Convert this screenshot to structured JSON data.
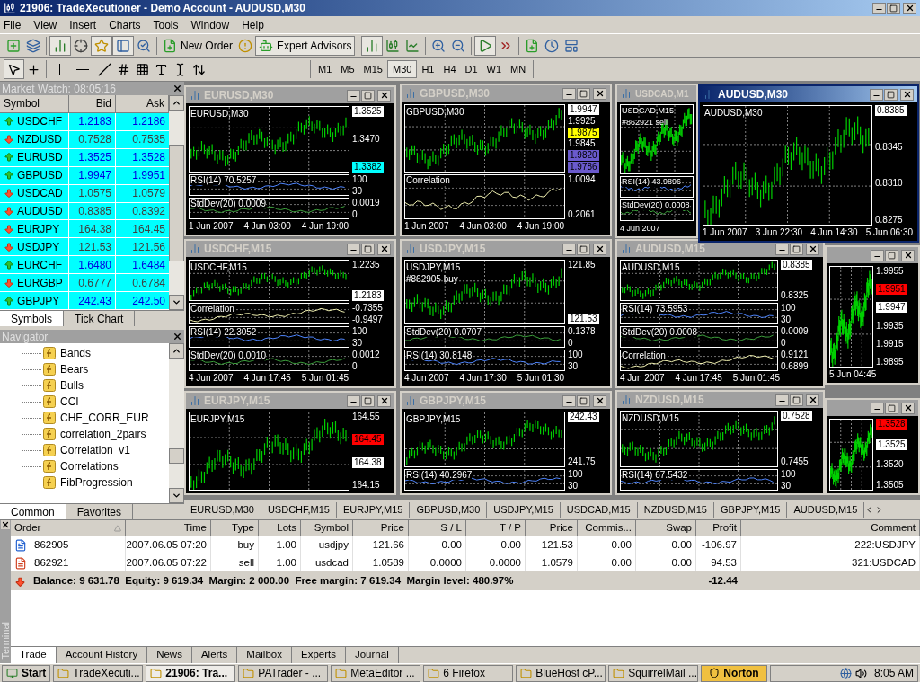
{
  "window": {
    "title": "21906: TradeXecutioner - Demo Account - AUDUSD,M30"
  },
  "menu": [
    "File",
    "View",
    "Insert",
    "Charts",
    "Tools",
    "Window",
    "Help"
  ],
  "toolbar": {
    "new_order": "New Order",
    "expert_advisors": {
      "label": "Expert Advisors",
      "on": true
    }
  },
  "timeframes": [
    {
      "label": "M1",
      "selected": false
    },
    {
      "label": "M5",
      "selected": false
    },
    {
      "label": "M15",
      "selected": false
    },
    {
      "label": "M30",
      "selected": true
    },
    {
      "label": "H1",
      "selected": false
    },
    {
      "label": "H4",
      "selected": false
    },
    {
      "label": "D1",
      "selected": false
    },
    {
      "label": "W1",
      "selected": false
    },
    {
      "label": "MN",
      "selected": false
    }
  ],
  "market_watch": {
    "title": "Market Watch: 08:05:16",
    "columns": [
      "Symbol",
      "Bid",
      "Ask"
    ],
    "rows": [
      {
        "symbol": "USDCHF",
        "bid": "1.2183",
        "ask": "1.2186",
        "up": true
      },
      {
        "symbol": "NZDUSD",
        "bid": "0.7528",
        "ask": "0.7535",
        "up": false
      },
      {
        "symbol": "EURUSD",
        "bid": "1.3525",
        "ask": "1.3528",
        "up": true
      },
      {
        "symbol": "GBPUSD",
        "bid": "1.9947",
        "ask": "1.9951",
        "up": true
      },
      {
        "symbol": "USDCAD",
        "bid": "1.0575",
        "ask": "1.0579",
        "up": false
      },
      {
        "symbol": "AUDUSD",
        "bid": "0.8385",
        "ask": "0.8392",
        "up": false
      },
      {
        "symbol": "EURJPY",
        "bid": "164.38",
        "ask": "164.45",
        "up": false
      },
      {
        "symbol": "USDJPY",
        "bid": "121.53",
        "ask": "121.56",
        "up": false
      },
      {
        "symbol": "EURCHF",
        "bid": "1.6480",
        "ask": "1.6484",
        "up": true
      },
      {
        "symbol": "EURGBP",
        "bid": "0.6777",
        "ask": "0.6784",
        "up": false
      },
      {
        "symbol": "GBPJPY",
        "bid": "242.43",
        "ask": "242.50",
        "up": true
      }
    ],
    "tabs": [
      {
        "label": "Symbols",
        "selected": true
      },
      {
        "label": "Tick Chart",
        "selected": false
      }
    ]
  },
  "navigator": {
    "title": "Navigator",
    "items": [
      "Bands",
      "Bears",
      "Bulls",
      "CCI",
      "CHF_CORR_EUR",
      "correlation_2pairs",
      "Correlation_v1",
      "Correlations",
      "FibProgression"
    ],
    "tabs": [
      {
        "label": "Common",
        "selected": true
      },
      {
        "label": "Favorites",
        "selected": false
      }
    ]
  },
  "charts": [
    {
      "title": "EURUSD,M30",
      "active": false,
      "header": "EURUSD,M30",
      "prices": [
        {
          "text": "1.3525",
          "color": "#ffffff"
        },
        {
          "text": "1.3470"
        },
        {
          "text": "1.3382",
          "color": "#00ffff"
        }
      ],
      "panes": [
        {
          "label": "RSI(14) 70.5257",
          "kind": "rsi",
          "ticks": [
            "100",
            "30"
          ]
        },
        {
          "label": "StdDev(20) 0.0009",
          "kind": "stddev",
          "ticks": [
            "0.0019",
            "0"
          ]
        }
      ],
      "times": [
        "1 Jun 2007",
        "4 Jun 03:00",
        "4 Jun 19:00"
      ]
    },
    {
      "title": "GBPUSD,M30",
      "active": false,
      "header": "GBPUSD,M30",
      "prices": [
        {
          "text": "1.9947",
          "color": "#ffffff"
        },
        {
          "text": "1.9925"
        },
        {
          "text": "1.9875",
          "color": "#ffff00"
        },
        {
          "text": "1.9845"
        },
        {
          "text": "1.9820",
          "color": "#6a5acd"
        },
        {
          "text": "1.9786",
          "color": "#6a5acd"
        }
      ],
      "panes": [
        {
          "label": "Correlation",
          "kind": "correlation",
          "ticks": [
            "1.0094",
            "0.2061"
          ]
        }
      ],
      "times": [
        "1 Jun 2007",
        "4 Jun 03:00",
        "4 Jun 19:00"
      ]
    },
    {
      "title": "USDCAD,M1",
      "active": false,
      "header": "USDCAD,M15",
      "note": "#862921 sell",
      "panes": [
        {
          "label": "RSI(14) 43.9896",
          "kind": "rsi"
        },
        {
          "label": "StdDev(20) 0.0008",
          "kind": "stddev"
        }
      ],
      "times": [
        "4 Jun 2007"
      ]
    },
    {
      "title": "AUDUSD,M30",
      "active": true,
      "header": "AUDUSD,M30",
      "prices": [
        {
          "text": "0.8385",
          "color": "#ffffff"
        },
        {
          "text": "0.8345"
        },
        {
          "text": "0.8310"
        },
        {
          "text": "0.8275"
        }
      ],
      "times": [
        "1 Jun 2007",
        "3 Jun 22:30",
        "4 Jun 14:30",
        "5 Jun 06:30"
      ]
    },
    {
      "title": "USDCHF,M15",
      "active": false,
      "header": "USDCHF,M15",
      "prices": [
        {
          "text": "1.2235"
        },
        {
          "text": "1.2183",
          "color": "#ffffff"
        }
      ],
      "panes": [
        {
          "label": "Correlation",
          "kind": "correlation",
          "ticks": [
            "-0.7355",
            "-0.9497"
          ]
        },
        {
          "label": "RSI(14) 22.3052",
          "kind": "rsi",
          "ticks": [
            "100",
            "30"
          ]
        },
        {
          "label": "StdDev(20) 0.0010",
          "kind": "stddev",
          "ticks": [
            "0.0012",
            "0"
          ]
        }
      ],
      "times": [
        "4 Jun 2007",
        "4 Jun 17:45",
        "5 Jun 01:45"
      ]
    },
    {
      "title": "USDJPY,M15",
      "active": false,
      "header": "USDJPY,M15",
      "note": "#862905 buy",
      "prices": [
        {
          "text": "121.85"
        },
        {
          "text": "121.53",
          "color": "#ffffff"
        }
      ],
      "panes": [
        {
          "label": "StdDev(20) 0.0707",
          "kind": "stddev",
          "ticks": [
            "0.1378",
            "0"
          ]
        },
        {
          "label": "RSI(14) 30.8148",
          "kind": "rsi",
          "ticks": [
            "100",
            "30"
          ]
        }
      ],
      "times": [
        "4 Jun 2007",
        "4 Jun 17:30",
        "5 Jun 01:30"
      ]
    },
    {
      "title": "AUDUSD,M15",
      "active": false,
      "header": "AUDUSD,M15",
      "prices": [
        {
          "text": "0.8385",
          "color": "#ffffff"
        },
        {
          "text": "0.8325"
        }
      ],
      "panes": [
        {
          "label": "RSI(14) 73.5953",
          "kind": "rsi",
          "ticks": [
            "100",
            "30"
          ]
        },
        {
          "label": "StdDev(20) 0.0008",
          "kind": "stddev",
          "ticks": [
            "0.0009",
            "0"
          ]
        },
        {
          "label": "Correlation",
          "kind": "correlation",
          "ticks": [
            "0.9121",
            "0.6899"
          ]
        }
      ],
      "times": [
        "4 Jun 2007",
        "4 Jun 17:45",
        "5 Jun 01:45"
      ]
    },
    {
      "active": false,
      "prices": [
        {
          "text": "1.9955"
        },
        {
          "text": "1.9951",
          "color": "#ff0000"
        },
        {
          "text": "1.9947",
          "color": "#ffffff"
        },
        {
          "text": "1.9935"
        },
        {
          "text": "1.9915"
        },
        {
          "text": "1.9895"
        }
      ],
      "times": [
        "5 Jun 04:45"
      ]
    },
    {
      "title": "EURJPY,M15",
      "active": false,
      "header": "EURJPY,M15",
      "prices": [
        {
          "text": "164.55"
        },
        {
          "text": "164.45",
          "color": "#ff0000"
        },
        {
          "text": "164.38",
          "color": "#ffffff"
        },
        {
          "text": "164.15"
        }
      ]
    },
    {
      "title": "GBPJPY,M15",
      "active": false,
      "header": "GBPJPY,M15",
      "prices": [
        {
          "text": "242.43",
          "color": "#ffffff"
        },
        {
          "text": "241.75"
        }
      ],
      "panes": [
        {
          "label": "RSI(14) 40.2967",
          "kind": "rsi",
          "ticks": [
            "100",
            "30"
          ]
        }
      ]
    },
    {
      "title": "NZDUSD,M15",
      "active": false,
      "header": "NZDUSD,M15",
      "prices": [
        {
          "text": "0.7528",
          "color": "#ffffff"
        },
        {
          "text": "0.7455"
        }
      ],
      "panes": [
        {
          "label": "RSI(14) 67.5432",
          "kind": "rsi",
          "ticks": [
            "100",
            "30"
          ]
        }
      ]
    },
    {
      "active": false,
      "prices": [
        {
          "text": "1.3528",
          "color": "#ff0000"
        },
        {
          "text": "1.3525",
          "color": "#ffffff"
        },
        {
          "text": "1.3520"
        },
        {
          "text": "1.3505"
        }
      ]
    }
  ],
  "chart_tabs": [
    "EURUSD,M30",
    "USDCHF,M15",
    "EURJPY,M15",
    "GBPUSD,M30",
    "USDJPY,M15",
    "USDCAD,M15",
    "NZDUSD,M15",
    "GBPJPY,M15",
    "AUDUSD,M15"
  ],
  "terminal": {
    "side_label": "Terminal",
    "columns": [
      "Order",
      "Time",
      "Type",
      "Lots",
      "Symbol",
      "Price",
      "S / L",
      "T / P",
      "Price",
      "Commis...",
      "Swap",
      "Profit",
      "Comment"
    ],
    "rows": [
      {
        "kind": "buy",
        "cells": [
          "862905",
          "2007.06.05 07:20",
          "buy",
          "1.00",
          "usdjpy",
          "121.66",
          "0.00",
          "0.00",
          "121.53",
          "0.00",
          "0.00",
          "-106.97",
          "222:USDJPY"
        ]
      },
      {
        "kind": "sell",
        "cells": [
          "862921",
          "2007.06.05 07:22",
          "sell",
          "1.00",
          "usdcad",
          "1.0589",
          "0.0000",
          "0.0000",
          "1.0579",
          "0.00",
          "0.00",
          "94.53",
          "321:USDCAD"
        ]
      }
    ],
    "summary": {
      "text": "Balance: 9 631.78  Equity: 9 619.34  Margin: 2 000.00  Free margin: 7 619.34  Margin level: 480.97%",
      "profit": "-12.44"
    },
    "tabs": [
      {
        "label": "Trade",
        "selected": true
      },
      {
        "label": "Account History",
        "selected": false
      },
      {
        "label": "News",
        "selected": false
      },
      {
        "label": "Alerts",
        "selected": false
      },
      {
        "label": "Mailbox",
        "selected": false
      },
      {
        "label": "Experts",
        "selected": false
      },
      {
        "label": "Journal",
        "selected": false
      }
    ]
  },
  "taskbar": {
    "start": "Start",
    "items": [
      {
        "label": "TradeXecuti...",
        "selected": false
      },
      {
        "label": "21906: Tra...",
        "selected": true
      },
      {
        "label": "PATrader - ...",
        "selected": false
      },
      {
        "label": "MetaEditor ...",
        "selected": false
      },
      {
        "label": "6 Firefox",
        "selected": false
      },
      {
        "label": "BlueHost cP...",
        "selected": false
      },
      {
        "label": "SquirrelMail ...",
        "selected": false
      }
    ],
    "tray_button": "Norton",
    "clock": "8:05 AM"
  }
}
